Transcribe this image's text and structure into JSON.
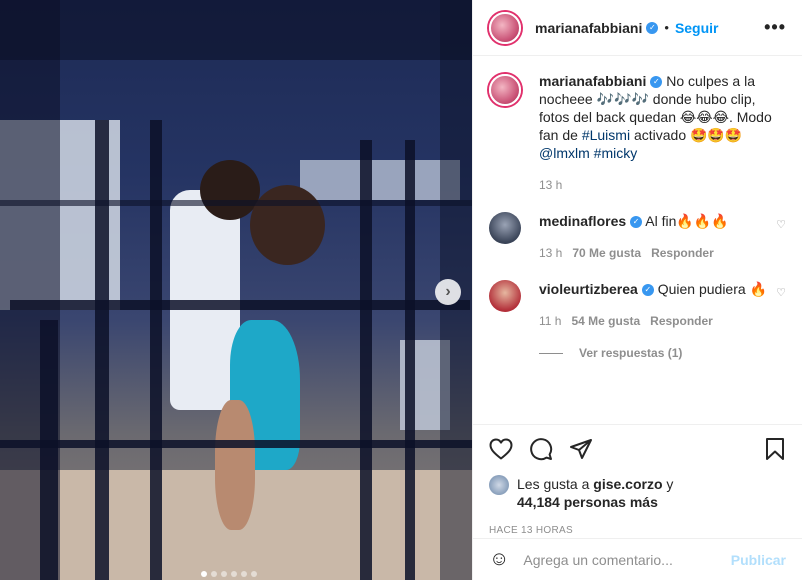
{
  "post": {
    "username": "marianafabbiani",
    "follow_label": "Seguir",
    "separator": "•",
    "more_label": "•••",
    "caption_text": "No culpes a la nocheee 🎶🎶🎶 donde hubo clip, fotos del back quedan 😂😂😂. Modo fan de",
    "caption_tag1": "#Luismi",
    "caption_mid": "activado 🤩🤩🤩",
    "caption_mention": "@lmxlm",
    "caption_tag2": "#micky",
    "caption_time": "13 h",
    "carousel_dots": 6,
    "carousel_active": 0
  },
  "comments": [
    {
      "username": "medinaflores",
      "text": "Al fin🔥🔥🔥",
      "time": "13 h",
      "likes": "70 Me gusta",
      "reply": "Responder",
      "avatar_color": "#3a4458"
    },
    {
      "username": "violeurtizberea",
      "text": "Quien pudiera 🔥",
      "time": "11 h",
      "likes": "54 Me gusta",
      "reply": "Responder",
      "avatar_color": "#b3303a"
    }
  ],
  "view_replies": "Ver respuestas (1)",
  "likes": {
    "prefix": "Les gusta a",
    "user": "gise.corzo",
    "connector": "y",
    "count": "44,184 personas más"
  },
  "timestamp": "HACE 13 HORAS",
  "add_comment": {
    "placeholder": "Agrega un comentario...",
    "publish_label": "Publicar",
    "emoji_icon": "☺"
  },
  "next_icon": "›",
  "heart_small": "♡",
  "verified_mark": "✓"
}
